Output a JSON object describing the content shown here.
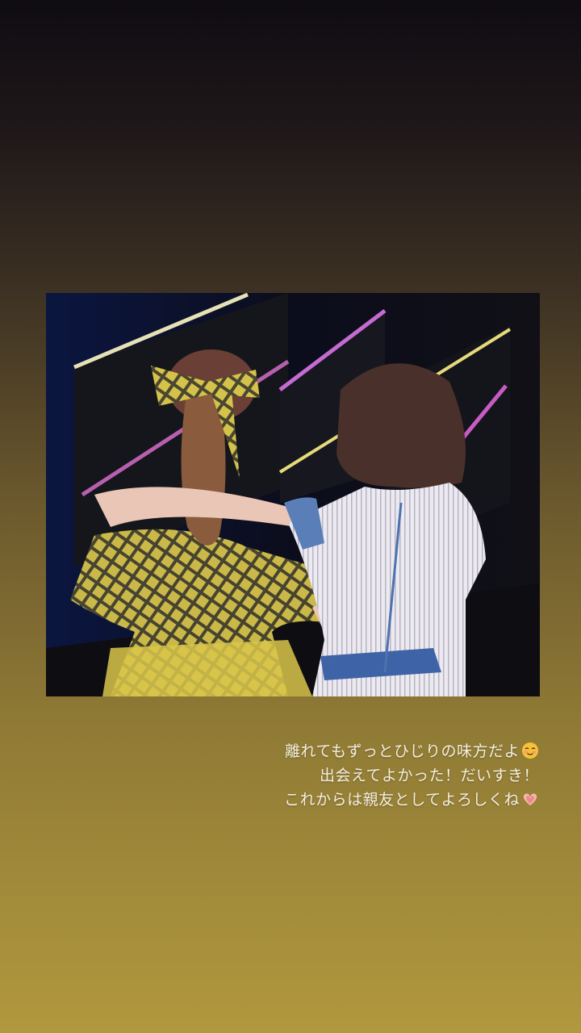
{
  "story": {
    "caption_lines": [
      "離れてもずっとひじりの味方だよ",
      "出会えてよかった！だいすき！",
      "これからは親友としてよろしくね"
    ],
    "emoji": [
      "relieved-smile-emoji",
      "heart-hands-emoji"
    ]
  },
  "colors": {
    "background_top": "#0f0c12",
    "background_bottom": "#b1983e",
    "caption_text": "#f4efe0"
  }
}
